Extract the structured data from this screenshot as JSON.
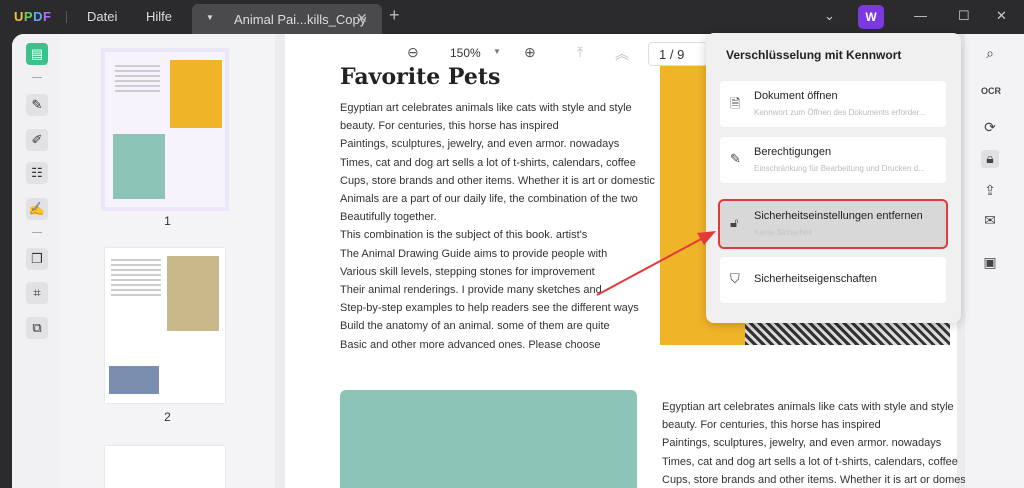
{
  "titlebar": {
    "logo": [
      "U",
      "P",
      "D",
      "F"
    ],
    "menu": [
      "Datei",
      "Hilfe"
    ],
    "tab_title": "Animal Pai...kills_Copy",
    "avatar": "W"
  },
  "toolbar": {
    "zoom": "150%",
    "page": "1 / 9"
  },
  "thumbnails": [
    {
      "page": "1"
    },
    {
      "page": "2"
    }
  ],
  "document": {
    "title": "Favorite Pets",
    "column1": [
      "Egyptian art celebrates animals like cats with style and style",
      "beauty. For centuries, this horse has inspired",
      "Paintings, sculptures, jewelry, and even armor. nowadays",
      "Times, cat and dog art sells a lot of t-shirts, calendars, coffee",
      "Cups, store brands and other items. Whether it is art or domestic",
      "Animals are a part of our daily life, the combination of the two",
      "Beautifully together.",
      "This combination is the subject of this book. artist's",
      "The Animal Drawing Guide aims to provide people with",
      "Various skill levels, stepping stones for improvement",
      "Their animal renderings. I provide many sketches and",
      "Step-by-step examples to help readers see the different ways",
      "Build the anatomy of an animal. some of them are quite",
      "Basic and other more advanced ones. Please choose"
    ],
    "column2": [
      "Egyptian art celebrates animals like cats with style and style",
      "beauty. For centuries, this horse has inspired",
      "Paintings, sculptures, jewelry, and even armor. nowadays",
      "Times, cat and dog art sells a lot of t-shirts, calendars, coffee",
      "Cups, store brands and other items. Whether it is art or domestic"
    ]
  },
  "popup": {
    "title": "Verschlüsselung mit Kennwort",
    "items": [
      {
        "label": "Dokument öffnen",
        "sub": "Kennwort zum Öffnen des Dokuments erforder..."
      },
      {
        "label": "Berechtigungen",
        "sub": "Einschränkung für Bearbeitung und Drucken d..."
      },
      {
        "label": "Sicherheitseinstellungen entfernen",
        "sub": "Keine Sicherheit"
      },
      {
        "label": "Sicherheitseigenschaften"
      }
    ]
  },
  "colors": {
    "accent": "#3cc18a",
    "highlight": "#e23a3a",
    "avatar": "#7a3ae0"
  }
}
